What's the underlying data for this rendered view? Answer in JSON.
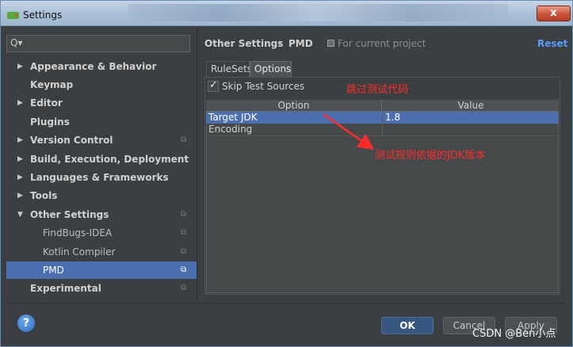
{
  "window": {
    "title": "Settings",
    "close_label": "x"
  },
  "search": {
    "placeholder": "",
    "glyph": "Q▾"
  },
  "sidebar": {
    "items": [
      {
        "label": "Appearance & Behavior"
      },
      {
        "label": "Keymap"
      },
      {
        "label": "Editor"
      },
      {
        "label": "Plugins"
      },
      {
        "label": "Version Control"
      },
      {
        "label": "Build, Execution, Deployment"
      },
      {
        "label": "Languages & Frameworks"
      },
      {
        "label": "Tools"
      },
      {
        "label": "Other Settings"
      },
      {
        "label": "FindBugs-IDEA"
      },
      {
        "label": "Kotlin Compiler"
      },
      {
        "label": "PMD"
      },
      {
        "label": "Experimental"
      }
    ]
  },
  "breadcrumb": {
    "parent": "Other Settings",
    "separator": "›",
    "current": "PMD",
    "note": "For current project"
  },
  "reset_label": "Reset",
  "tabs": [
    {
      "label": "RuleSets"
    },
    {
      "label": "Options"
    }
  ],
  "options": {
    "skip_test_sources_label": "Skip Test Sources",
    "table": {
      "headers": [
        "Option",
        "Value"
      ],
      "rows": [
        {
          "option": "Target JDK",
          "value": "1.8"
        },
        {
          "option": "Encoding",
          "value": ""
        }
      ]
    }
  },
  "annotations": {
    "skip_note": "跳过测试代码",
    "jdk_note": "测试规则依据的JDK版本"
  },
  "buttons": {
    "help": "?",
    "ok": "OK",
    "cancel": "Cancel",
    "apply": "Apply"
  },
  "watermark": "CSDN @Ben小点",
  "colors": {
    "selection": "#4b6eaf",
    "accent_link": "#589df6",
    "annotation": "#ff2b2b",
    "panel_bg": "#3c3f41"
  }
}
